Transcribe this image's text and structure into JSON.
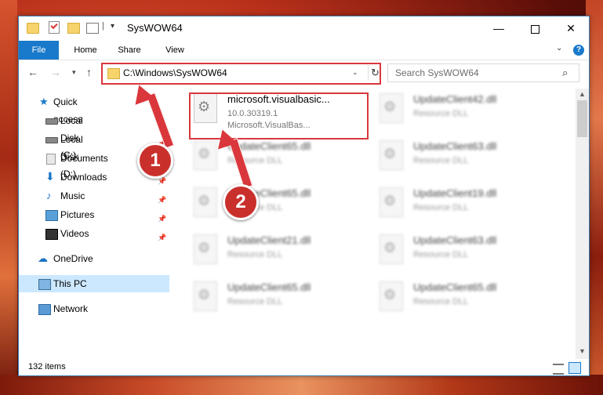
{
  "window": {
    "title": "SysWOW64",
    "minimize_glyph": "—",
    "close_glyph": "✕"
  },
  "ribbon": {
    "tabs": [
      "File",
      "Home",
      "Share",
      "View"
    ]
  },
  "navigation": {
    "address": "C:\\Windows\\SysWOW64",
    "search_placeholder": "Search SysWOW64"
  },
  "sidebar": {
    "items": [
      {
        "label": "Quick access",
        "icon": "star-icon"
      },
      {
        "label": "Local Disk (C:)",
        "icon": "disk-icon",
        "pinned": true
      },
      {
        "label": "Local Disk (D:)",
        "icon": "disk-icon",
        "pinned": true
      },
      {
        "label": "Documents",
        "icon": "documents-icon",
        "pinned": true
      },
      {
        "label": "Downloads",
        "icon": "download-icon",
        "pinned": true
      },
      {
        "label": "Music",
        "icon": "music-icon",
        "pinned": true
      },
      {
        "label": "Pictures",
        "icon": "pictures-icon",
        "pinned": true
      },
      {
        "label": "Videos",
        "icon": "videos-icon",
        "pinned": true
      },
      {
        "label": "OneDrive",
        "icon": "cloud-icon"
      },
      {
        "label": "This PC",
        "icon": "computer-icon",
        "selected": true
      },
      {
        "label": "Network",
        "icon": "network-icon"
      }
    ]
  },
  "files": [
    {
      "name": "microsoft.visualbasic...",
      "line2": "10.0.30319.1",
      "line3": "Microsoft.VisualBas..."
    },
    {
      "name": "UpdateClient42.dll",
      "line2": "Resource DLL"
    },
    {
      "name": "UpdateClient65.dll",
      "line2": "Resource DLL"
    },
    {
      "name": "UpdateClient63.dll",
      "line2": "Resource DLL"
    },
    {
      "name": "UpdateClient65.dll",
      "line2": "Resource DLL"
    },
    {
      "name": "UpdateClient19.dll",
      "line2": "Resource DLL"
    },
    {
      "name": "UpdateClient21.dll",
      "line2": "Resource DLL"
    },
    {
      "name": "UpdateClient63.dll",
      "line2": "Resource DLL"
    },
    {
      "name": "UpdateClient65.dll",
      "line2": "Resource DLL"
    },
    {
      "name": "UpdateClient65.dll",
      "line2": "Resource DLL"
    }
  ],
  "status": {
    "item_count": "132 items"
  },
  "annotations": {
    "marker1": "1",
    "marker2": "2",
    "color": "#d9373c"
  }
}
